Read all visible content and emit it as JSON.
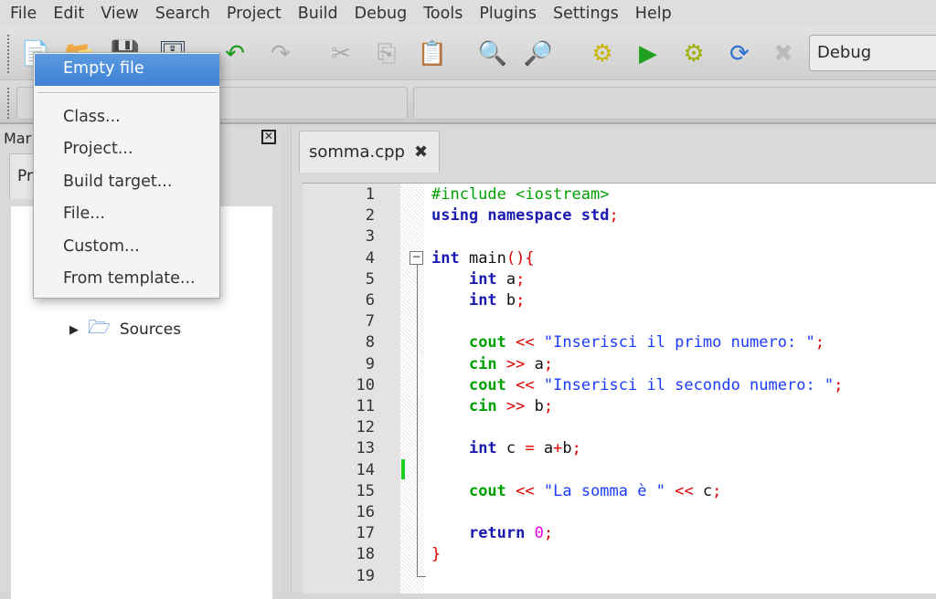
{
  "menubar": [
    "File",
    "Edit",
    "View",
    "Search",
    "Project",
    "Build",
    "Debug",
    "Tools",
    "Plugins",
    "Settings",
    "Help"
  ],
  "toolbar": {
    "icons": [
      "new-file-icon",
      "open-icon",
      "save-icon",
      "save-all-icon",
      "undo-icon",
      "redo-icon",
      "cut-icon",
      "copy-icon",
      "paste-icon",
      "find-icon",
      "replace-icon",
      "build-icon",
      "run-icon",
      "build-run-icon",
      "rebuild-icon",
      "abort-icon"
    ],
    "build_target": "Debug"
  },
  "new_menu": {
    "items": [
      "Empty file",
      "Class...",
      "Project...",
      "Build target...",
      "File...",
      "Custom...",
      "From template..."
    ],
    "highlighted": "Empty file"
  },
  "management": {
    "title": "Mar",
    "tab": "Pr",
    "tree_item": "Sources"
  },
  "editor": {
    "tab": "somma.cpp",
    "lines": [
      [
        [
          "pp",
          "#include <iostream>"
        ]
      ],
      [
        [
          "kw",
          "using namespace std"
        ],
        [
          "op",
          ";"
        ]
      ],
      [],
      [
        [
          "kw",
          "int"
        ],
        [
          "tx",
          " main"
        ],
        [
          "op",
          "(){"
        ]
      ],
      [
        [
          "tx",
          "    "
        ],
        [
          "kw",
          "int"
        ],
        [
          "tx",
          " a"
        ],
        [
          "op",
          ";"
        ]
      ],
      [
        [
          "tx",
          "    "
        ],
        [
          "kw",
          "int"
        ],
        [
          "tx",
          " b"
        ],
        [
          "op",
          ";"
        ]
      ],
      [],
      [
        [
          "tx",
          "    "
        ],
        [
          "io",
          "cout"
        ],
        [
          "tx",
          " "
        ],
        [
          "op",
          "<<"
        ],
        [
          "tx",
          " "
        ],
        [
          "st",
          "\"Inserisci il primo numero: \""
        ],
        [
          "op",
          ";"
        ]
      ],
      [
        [
          "tx",
          "    "
        ],
        [
          "io",
          "cin"
        ],
        [
          "tx",
          " "
        ],
        [
          "op",
          ">>"
        ],
        [
          "tx",
          " a"
        ],
        [
          "op",
          ";"
        ]
      ],
      [
        [
          "tx",
          "    "
        ],
        [
          "io",
          "cout"
        ],
        [
          "tx",
          " "
        ],
        [
          "op",
          "<<"
        ],
        [
          "tx",
          " "
        ],
        [
          "st",
          "\"Inserisci il secondo numero: \""
        ],
        [
          "op",
          ";"
        ]
      ],
      [
        [
          "tx",
          "    "
        ],
        [
          "io",
          "cin"
        ],
        [
          "tx",
          " "
        ],
        [
          "op",
          ">>"
        ],
        [
          "tx",
          " b"
        ],
        [
          "op",
          ";"
        ]
      ],
      [],
      [
        [
          "tx",
          "    "
        ],
        [
          "kw",
          "int"
        ],
        [
          "tx",
          " c "
        ],
        [
          "op",
          "="
        ],
        [
          "tx",
          " a"
        ],
        [
          "op",
          "+"
        ],
        [
          "tx",
          "b"
        ],
        [
          "op",
          ";"
        ]
      ],
      [],
      [
        [
          "tx",
          "    "
        ],
        [
          "io",
          "cout"
        ],
        [
          "tx",
          " "
        ],
        [
          "op",
          "<<"
        ],
        [
          "tx",
          " "
        ],
        [
          "st",
          "\"La somma è \""
        ],
        [
          "tx",
          " "
        ],
        [
          "op",
          "<<"
        ],
        [
          "tx",
          " c"
        ],
        [
          "op",
          ";"
        ]
      ],
      [],
      [
        [
          "tx",
          "    "
        ],
        [
          "kw",
          "return"
        ],
        [
          "tx",
          " "
        ],
        [
          "nm",
          "0"
        ],
        [
          "op",
          ";"
        ]
      ],
      [
        [
          "op",
          "}"
        ]
      ],
      []
    ]
  }
}
